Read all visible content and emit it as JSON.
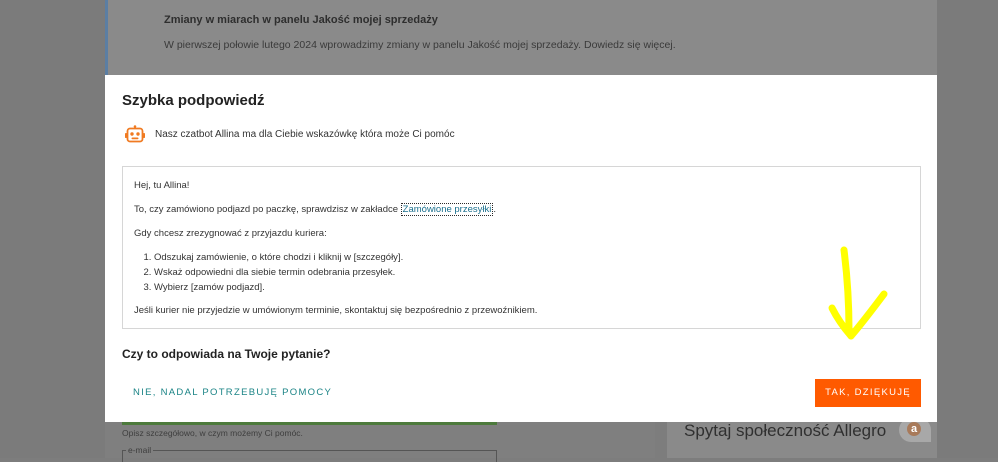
{
  "background": {
    "notice_title": "Zmiany w miarach w panelu Jakość mojej sprzedaży",
    "notice_text": "W pierwszej połowie lutego 2024 wprowadzimy zmiany w panelu Jakość mojej sprzedaży. Dowiedz się więcej.",
    "form_hint": "Opisz szczegółowo, w czym możemy Ci pomóc.",
    "email_label": "e-mail",
    "community_title": "Spytaj społeczność Allegro",
    "community_logo": "a"
  },
  "modal": {
    "title": "Szybka podpowiedź",
    "bot_icon": "robot-icon",
    "bot_message": "Nasz czatbot Allina ma dla Ciebie wskazówkę która może Ci pomóc",
    "answer": {
      "greeting": "Hej, tu Allina!",
      "line1_prefix": "To, czy zamówiono podjazd po paczkę, sprawdzisz w zakładce ",
      "line1_link": "Zamówione przesyłki",
      "line1_suffix": ".",
      "line2": "Gdy chcesz zrezygnować z przyjazdu kuriera:",
      "steps": [
        "Odszukaj zamówienie, o które chodzi i kliknij w [szczegóły].",
        "Wskaż odpowiedni dla siebie termin odebrania przesyłek.",
        "Wybierz [zamów podjazd]."
      ],
      "footer": "Jeśli kurier nie przyjedzie w umówionym terminie, skontaktuj się bezpośrednio z przewoźnikiem."
    },
    "question": "Czy to odpowiada na Twoje pytanie?",
    "no_button": "NIE, NADAL POTRZEBUJĘ POMOCY",
    "yes_button": "TAK, DZIĘKUJĘ"
  },
  "colors": {
    "accent_orange": "#ff5a00",
    "link_teal": "#1b8486",
    "annotation_yellow": "#ffff00"
  }
}
